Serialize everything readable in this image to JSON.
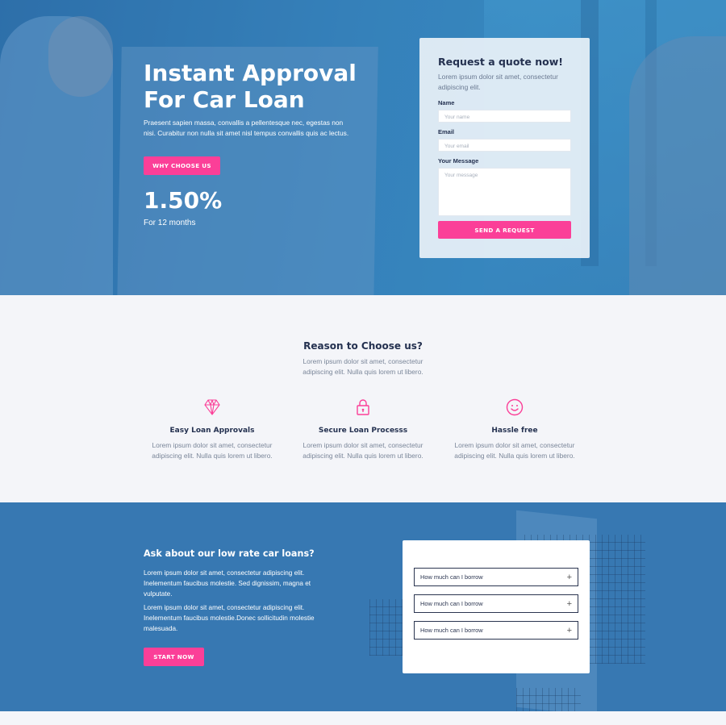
{
  "hero": {
    "title": "Instant Approval For Car Loan",
    "text": "Praesent sapien massa, convallis a pellentesque nec, egestas non nisi. Curabitur non nulla sit amet nisl tempus convallis quis ac lectus.",
    "cta_label": "Why choose us",
    "rate": "1.50%",
    "rate_subtitle": "For 12 months"
  },
  "quote_form": {
    "title": "Request a quote now!",
    "subtitle": "Lorem ipsum dolor sit amet, consectetur adipiscing elit.",
    "name_label": "Name",
    "name_placeholder": "Your name",
    "email_label": "Email",
    "email_placeholder": "Your email",
    "message_label": "Your Message",
    "message_placeholder": "Your message",
    "submit_label": "Send a request"
  },
  "reasons": {
    "title": "Reason to Choose us?",
    "lead": "Lorem ipsum dolor sit amet, consectetur adipiscing elit. Nulla quis lorem ut libero.",
    "features": [
      {
        "icon": "diamond-icon",
        "title": "Easy Loan Approvals",
        "text": "Lorem ipsum dolor sit amet, consectetur adipiscing elit. Nulla quis lorem ut libero."
      },
      {
        "icon": "lock-icon",
        "title": "Secure Loan Processs",
        "text": "Lorem ipsum dolor sit amet, consectetur adipiscing elit. Nulla quis lorem ut libero."
      },
      {
        "icon": "smile-icon",
        "title": "Hassle free",
        "text": "Lorem ipsum dolor sit amet, consectetur adipiscing elit. Nulla quis lorem ut libero."
      }
    ]
  },
  "loan": {
    "title": "Ask about our low rate car loans?",
    "paragraph1": "Lorem ipsum dolor sit amet, consectetur adipiscing elit. Inelementum faucibus molestie. Sed dignissim, magna et vulputate.",
    "paragraph2": "Lorem ipsum dolor sit amet, consectetur adipiscing elit. Inelementum faucibus molestie.Donec sollicitudin molestie malesuada.",
    "cta_label": "Start now",
    "faq": [
      {
        "question": "How much can I borrow"
      },
      {
        "question": "How much can I borrow"
      },
      {
        "question": "How much can I borrow"
      }
    ]
  },
  "colors": {
    "accent": "#fb3f98",
    "hero_blue": "#3a86bd",
    "heading": "#243150",
    "section_bg": "#f4f5f9"
  }
}
